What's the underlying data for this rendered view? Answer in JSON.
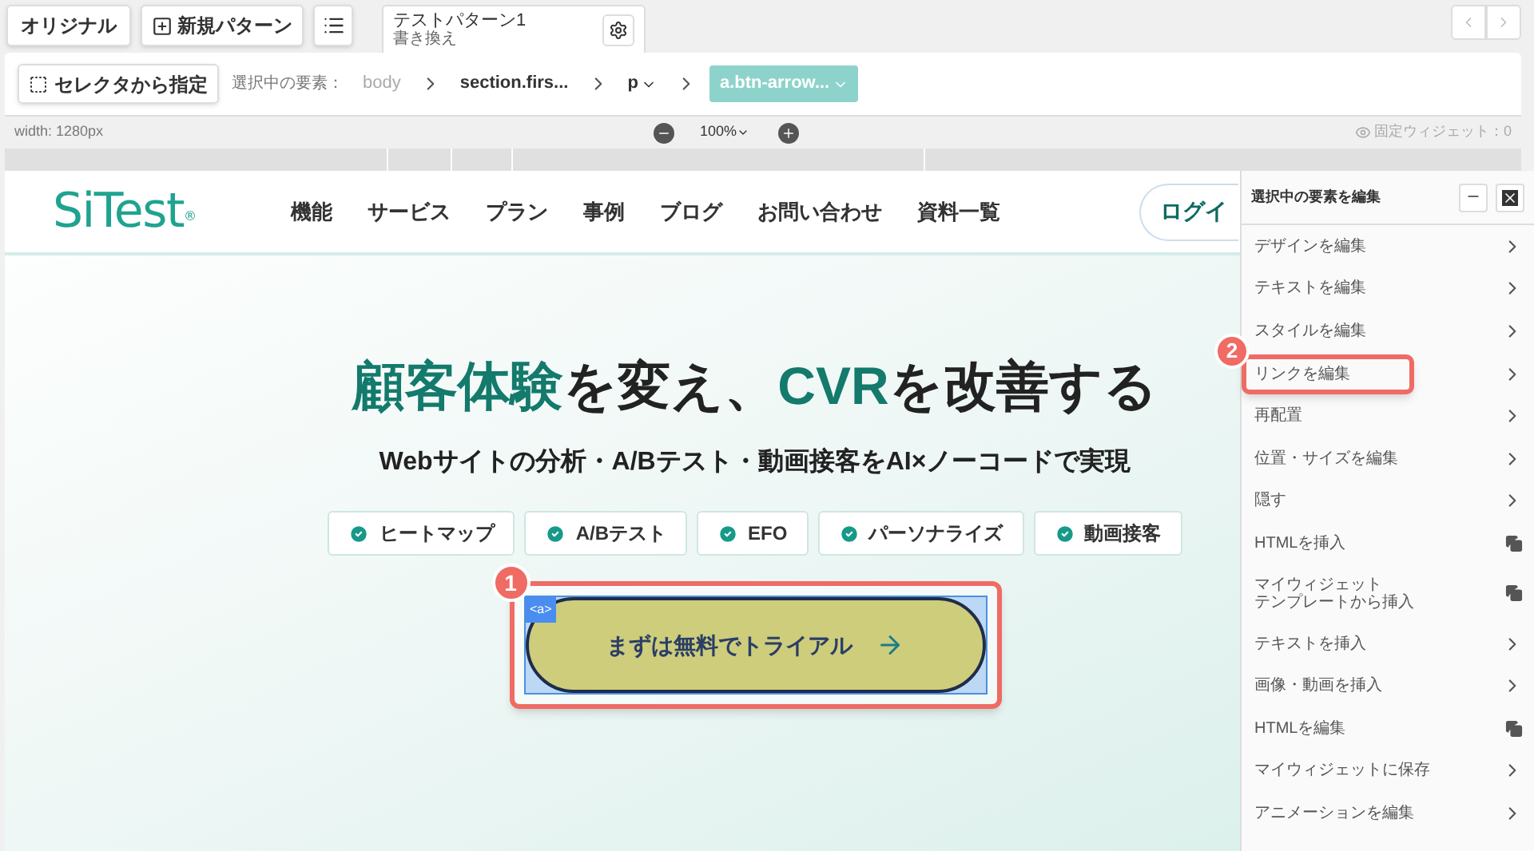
{
  "top_bar": {
    "original_button": "オリジナル",
    "new_pattern_button": "新規パターン",
    "pattern_tab": {
      "title": "テストパターン1",
      "subtitle": "書き換え"
    }
  },
  "selector_bar": {
    "selector_button": "セレクタから指定",
    "label": "選択中の要素：",
    "breadcrumb": [
      {
        "text": "body",
        "muted": true,
        "dropdown": false,
        "selected": false
      },
      {
        "text": "section.firs...",
        "muted": false,
        "dropdown": false,
        "selected": false
      },
      {
        "text": "p",
        "muted": false,
        "dropdown": true,
        "selected": false
      },
      {
        "text": "a.btn-arrow...",
        "muted": false,
        "dropdown": true,
        "selected": true
      }
    ]
  },
  "view_bar": {
    "width_label": "width: 1280px",
    "zoom": "100%",
    "fixed_widgets": "固定ウィジェット：0"
  },
  "site": {
    "logo": "SiTest",
    "logo_mark": "®",
    "nav": [
      "機能",
      "サービス",
      "プラン",
      "事例",
      "ブログ",
      "お問い合わせ",
      "資料一覧"
    ],
    "login": "ログイ",
    "headline": [
      {
        "text": "顧客体験",
        "accent": true
      },
      {
        "text": "を変え、",
        "accent": false
      },
      {
        "text": "CVR",
        "accent": true
      },
      {
        "text": "を改善する",
        "accent": false
      }
    ],
    "subtitle": "Webサイトの分析・A/Bテスト・動画接客をAI×ノーコードで実現",
    "features": [
      "ヒートマップ",
      "A/Bテスト",
      "EFO",
      "パーソナライズ",
      "動画接客"
    ],
    "cta": {
      "tag": "<a>",
      "label": "まずは無料でトライアル",
      "callout": "1"
    }
  },
  "edit_panel": {
    "title": "選択中の要素を編集",
    "items": [
      {
        "label": "デザインを編集",
        "kind": "chevron"
      },
      {
        "label": "テキストを編集",
        "kind": "chevron"
      },
      {
        "label": "スタイルを編集",
        "kind": "chevron"
      },
      {
        "label": "リンクを編集",
        "kind": "chevron",
        "callout": "2"
      },
      {
        "label": "再配置",
        "kind": "chevron"
      },
      {
        "label": "位置・サイズを編集",
        "kind": "chevron"
      },
      {
        "label": "隠す",
        "kind": "chevron"
      },
      {
        "label": "HTMLを挿入",
        "kind": "copy"
      },
      {
        "lines": [
          "マイウィジェット",
          "テンプレートから挿入"
        ],
        "kind": "copy"
      },
      {
        "label": "テキストを挿入",
        "kind": "chevron"
      },
      {
        "label": "画像・動画を挿入",
        "kind": "chevron"
      },
      {
        "label": "HTMLを編集",
        "kind": "copy"
      },
      {
        "label": "マイウィジェットに保存",
        "kind": "chevron"
      },
      {
        "label": "アニメーションを編集",
        "kind": "chevron"
      }
    ]
  }
}
